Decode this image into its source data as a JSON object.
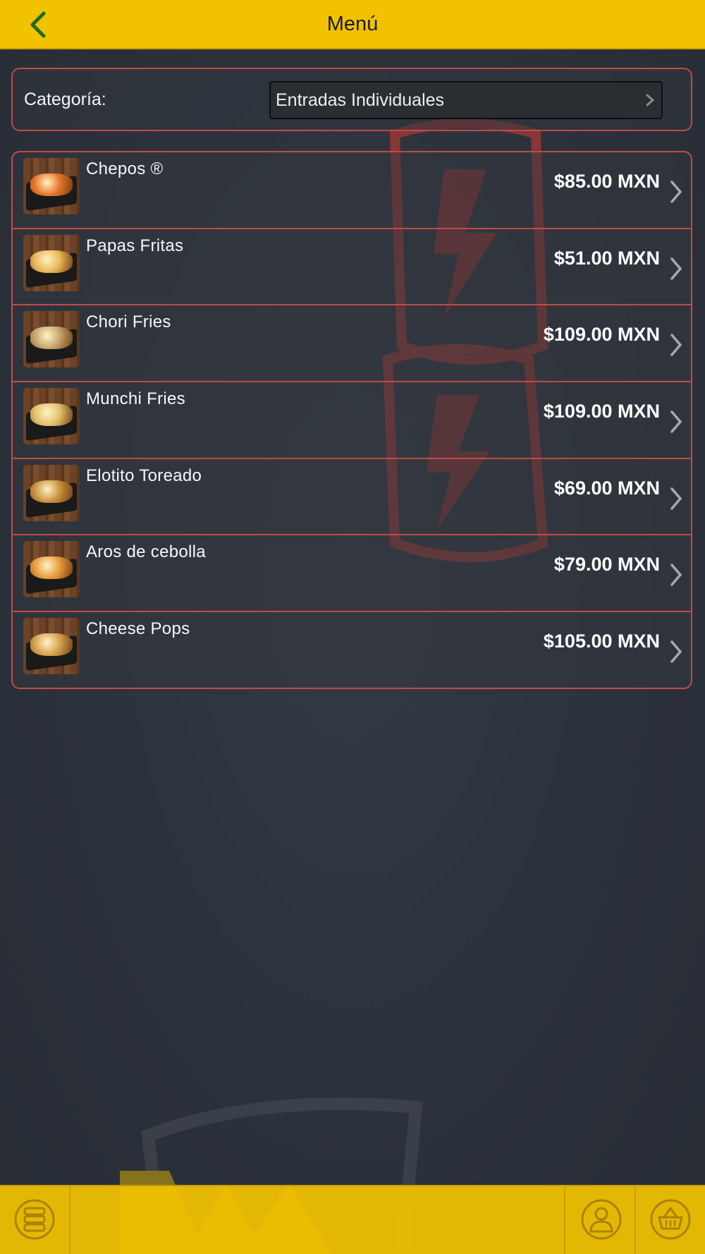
{
  "header": {
    "title": "Menú",
    "back_icon": "chevron-left-icon",
    "colors": {
      "bar": "#f2c200",
      "back_icon": "#1f6b1f"
    }
  },
  "category": {
    "label": "Categoría:",
    "selected": "Entradas Individuales"
  },
  "items": [
    {
      "name": "Chepos ®",
      "price": "$85.00 MXN",
      "food_color": "#e8742a"
    },
    {
      "name": "Papas Fritas",
      "price": "$51.00 MXN",
      "food_color": "#e9b555"
    },
    {
      "name": "Chori Fries",
      "price": "$109.00 MXN",
      "food_color": "#c7a36a"
    },
    {
      "name": "Munchi Fries",
      "price": "$109.00 MXN",
      "food_color": "#e2c06a"
    },
    {
      "name": "Elotito Toreado",
      "price": "$69.00 MXN",
      "food_color": "#c9913e"
    },
    {
      "name": "Aros de cebolla",
      "price": "$79.00 MXN",
      "food_color": "#e89a3a"
    },
    {
      "name": "Cheese Pops",
      "price": "$105.00 MXN",
      "food_color": "#d6a14e"
    }
  ],
  "footer": {
    "buttons": [
      {
        "icon": "menu-stack-icon"
      },
      {
        "icon": "user-icon"
      },
      {
        "icon": "basket-icon"
      }
    ]
  },
  "colors": {
    "accent": "#f2c200",
    "border": "#c24a44",
    "background": "#2c323c"
  }
}
